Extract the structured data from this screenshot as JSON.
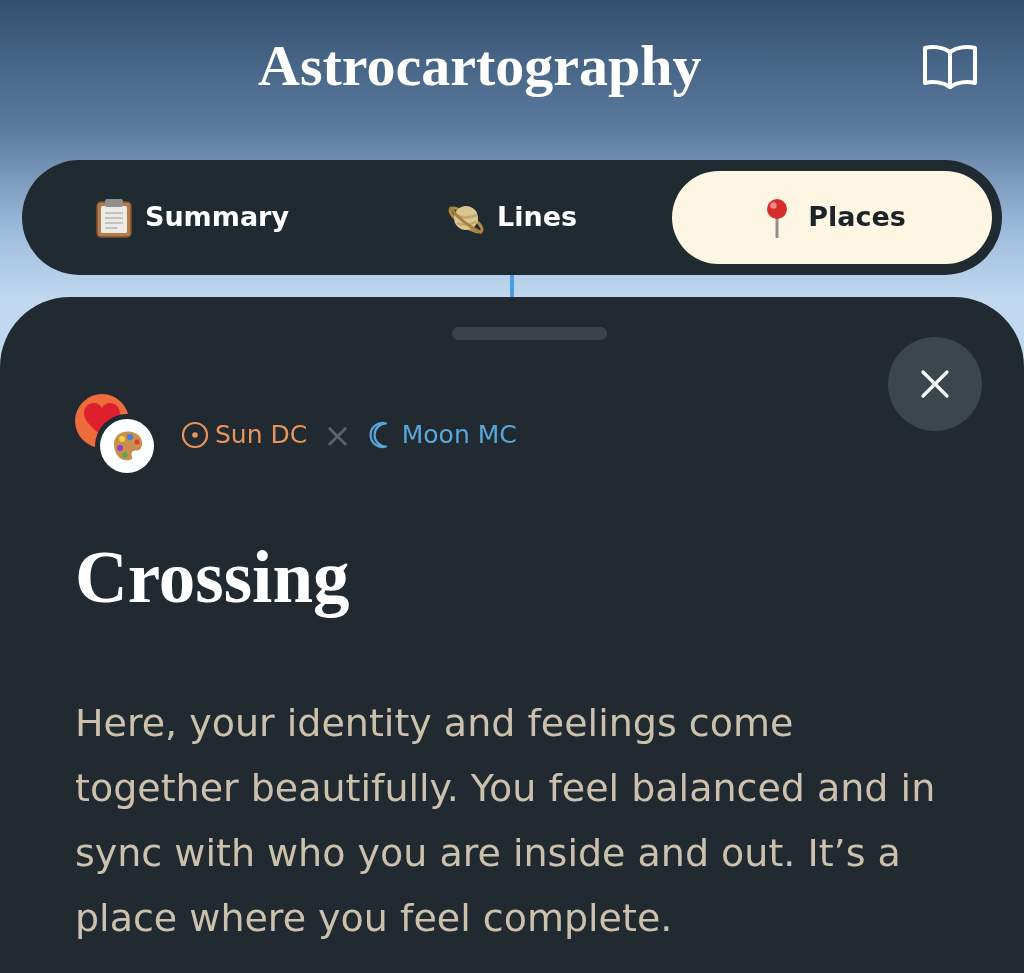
{
  "header": {
    "title": "Astrocartography"
  },
  "tabs": [
    {
      "label": "Summary",
      "selected": false
    },
    {
      "label": "Lines",
      "selected": false
    },
    {
      "label": "Places",
      "selected": true
    }
  ],
  "sheet": {
    "lines": [
      {
        "label": "Sun DC",
        "color": "#e8955c"
      },
      {
        "label": "Moon MC",
        "color": "#5aa6da"
      }
    ],
    "separator": "×",
    "title": "Crossing",
    "text": "Here, your identity and feelings come together beautifully. You feel balanced and in sync with who you are inside and out. It’s a place where you feel complete."
  }
}
